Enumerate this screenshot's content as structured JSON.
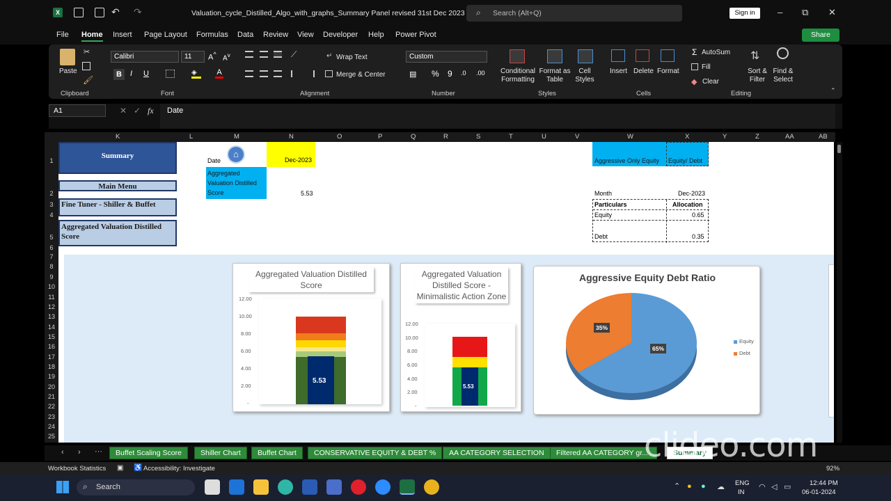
{
  "titlebar": {
    "doc_title": "Valuation_cycle_Distilled_Algo_with_graphs_Summary Panel revised 31st Dec 2023  -  Excel",
    "search_placeholder": "Search (Alt+Q)",
    "sign_in": "Sign in",
    "minimize": "–",
    "restore": "⧉",
    "close": "✕"
  },
  "menu": {
    "items": [
      "File",
      "Home",
      "Insert",
      "Page Layout",
      "Formulas",
      "Data",
      "Review",
      "View",
      "Developer",
      "Help",
      "Power Pivot"
    ],
    "active": "Home",
    "share": "Share"
  },
  "ribbon": {
    "paste": "Paste",
    "font_name": "Calibri",
    "font_size": "11",
    "wrap_text": "Wrap Text",
    "merge_center": "Merge & Center",
    "number_format": "Custom",
    "conditional_formatting": "Conditional Formatting",
    "format_as_table": "Format as Table",
    "cell_styles": "Cell Styles",
    "insert": "Insert",
    "delete": "Delete",
    "format": "Format",
    "autosum": "AutoSum",
    "fill": "Fill",
    "clear": "Clear",
    "sort_filter": "Sort & Filter",
    "find_select": "Find & Select",
    "groups": [
      "Clipboard",
      "Font",
      "Alignment",
      "Number",
      "Styles",
      "Cells",
      "Editing"
    ]
  },
  "formula_bar": {
    "name_box": "A1",
    "formula": "Date"
  },
  "columns": [
    "K",
    "L",
    "M",
    "N",
    "O",
    "P",
    "Q",
    "R",
    "S",
    "T",
    "U",
    "V",
    "W",
    "X",
    "Y",
    "Z",
    "AA",
    "AB"
  ],
  "rows": [
    "1",
    "2",
    "3",
    "4",
    "5",
    "6",
    "7",
    "8",
    "9",
    "10",
    "11",
    "12",
    "13",
    "14",
    "15",
    "16",
    "17",
    "18",
    "19",
    "20",
    "21",
    "22",
    "23",
    "24",
    "25"
  ],
  "sheet": {
    "nav_summary": "Summary",
    "nav_main_menu": "Main Menu",
    "nav_fine_tuner": "Fine Tuner - Shiller & Buffet",
    "nav_aggregated": "Aggregated Valuation Distilled Score",
    "date_label": "Date",
    "date_value": "Dec-2023",
    "agg_label": "Aggregated Valuation Distilled Score",
    "agg_value": "5.53",
    "aggressive_only_equity": "Aggressive Only Equity",
    "equity_debt": "Equity/ Debt",
    "month_label": "Month",
    "month_value": "Dec-2023",
    "particulars": "Particulars",
    "allocation": "Allocation",
    "equity": "Equity",
    "equity_value": "0.65",
    "debt": "Debt",
    "debt_value": "0.35"
  },
  "chart_data": [
    {
      "type": "bar",
      "title": "Aggregated Valuation Distilled Score",
      "ylim": [
        0,
        12
      ],
      "yticks": [
        "12.00",
        "10.00",
        "8.00",
        "6.00",
        "4.00",
        "2.00",
        "-"
      ],
      "value": 5.53,
      "value_label": "5.53"
    },
    {
      "type": "bar",
      "title": "Aggregated Valuation Distilled Score - Minimalistic Action Zone",
      "ylim": [
        0,
        12
      ],
      "yticks": [
        "12.00",
        "10.00",
        "8.00",
        "6.00",
        "4.00",
        "2.00",
        "-"
      ],
      "value": 5.53,
      "value_label": "5.53"
    },
    {
      "type": "pie",
      "title": "Aggressive Equity Debt Ratio",
      "categories": [
        "Equity",
        "Debt"
      ],
      "values": [
        65,
        35
      ],
      "labels": [
        "65%",
        "35%"
      ],
      "colors": [
        "#5b9bd5",
        "#ed7d31"
      ],
      "legend": "right"
    }
  ],
  "tabs": [
    "Buffet Scaling Score",
    "Shiller Chart",
    "Buffet Chart",
    "CONSERVATIVE EQUITY & DEBT %",
    "AA CATEGORY SELECTION",
    "Filtered AA CATEGORY gr...",
    "Summary"
  ],
  "watermark": "clideo.com",
  "status": {
    "workbook_stats": "Workbook Statistics",
    "accessibility": "Accessibility: Investigate",
    "zoom": "92%"
  },
  "taskbar": {
    "search": "Search",
    "lang": "ENG",
    "region": "IN",
    "time": "12:44 PM",
    "date": "06-01-2024"
  }
}
